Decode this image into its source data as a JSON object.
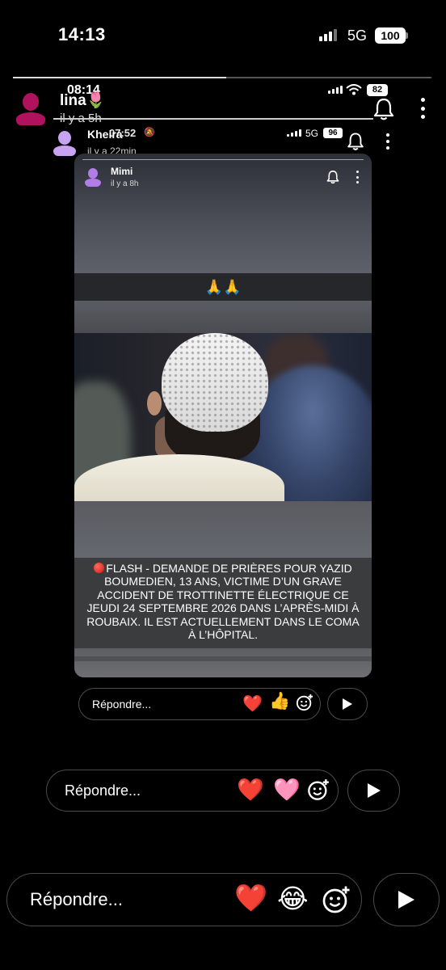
{
  "status_bar": {
    "time": "14:13",
    "network": "5G",
    "battery": "100"
  },
  "story_outer": {
    "username": "lina🌷",
    "posted": "il y a 5h",
    "status_time": "08:14",
    "battery": "82",
    "reply_placeholder": "Répondre...",
    "reactions": [
      "❤️",
      "😂"
    ],
    "icons": [
      "bell-icon",
      "more-vertical-icon",
      "add-reaction-icon",
      "send-icon"
    ]
  },
  "story_middle": {
    "username": "Kheira",
    "posted": "il y a 22min",
    "status_time": "07:52",
    "status_mute_icon": "🔕",
    "network": "5G",
    "battery": "96",
    "reply_placeholder": "Répondre...",
    "reactions": [
      "❤️",
      "🩷"
    ]
  },
  "story_inner": {
    "username": "Mimi",
    "posted": "il y a 8h",
    "prayer_emoji": "🙏🙏",
    "flash_text": "FLASH - DEMANDE DE PRIÈRES POUR YAZID BOUMEDIEN, 13 ANS, VICTIME D’UN GRAVE ACCIDENT DE TROTTINETTE ÉLECTRIQUE CE JEUDI 24 SEPTEMBRE 2026 DANS L’APRÈS-MIDI À ROUBAIX. IL EST ACTUELLEMENT DANS LE COMA À L’HÔPITAL.",
    "reply_placeholder": "Répondre...",
    "reactions": [
      "❤️",
      "👍"
    ]
  },
  "colors": {
    "background": "#000000",
    "avatar_outer": "#b0125e",
    "avatar_middle": "#c8a3f2",
    "avatar_inner": "#b27de8",
    "heart": "#ee1d24",
    "flash_dot": "#e0251a"
  }
}
